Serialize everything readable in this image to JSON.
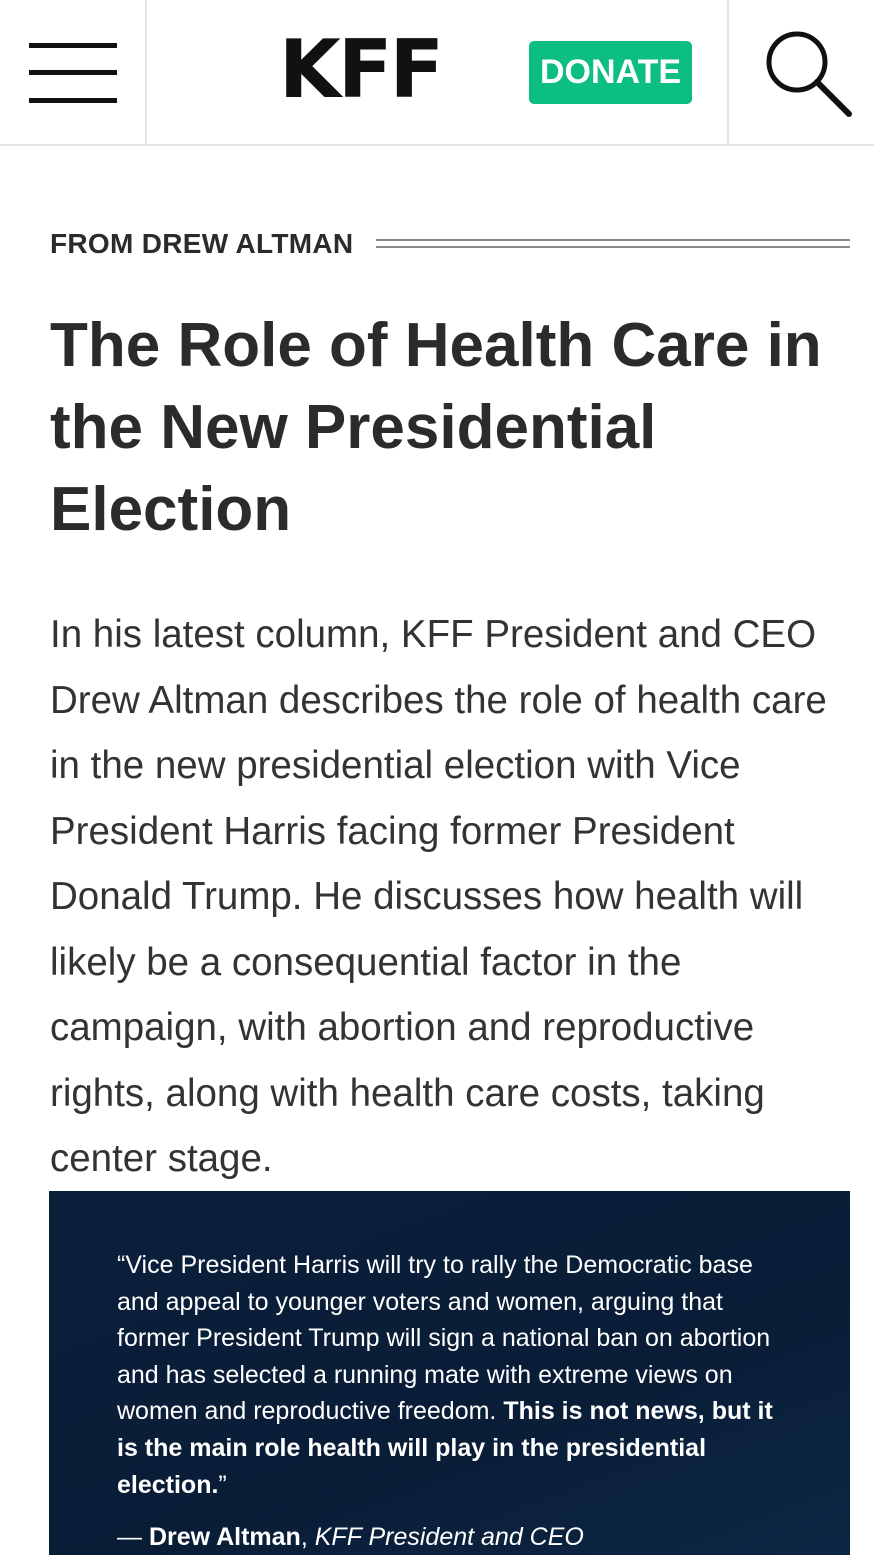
{
  "header": {
    "menu_icon": "hamburger-menu-icon",
    "logo_text": "KFF",
    "donate_label": "DONATE",
    "search_icon": "search-icon",
    "accent_color": "#0cbd84"
  },
  "article": {
    "kicker": "FROM DREW ALTMAN",
    "title": "The Role of Health Care in the New Presidential Election",
    "lede": "In his latest column, KFF President and CEO Drew Altman describes the role of health care in the new presidential election with Vice President Harris facing former President Donald Trump. He discusses how health will likely be a consequential factor in the campaign, with abortion and reproductive rights, along with health care costs, taking center stage."
  },
  "quote": {
    "open_mark": "“",
    "text_regular": "Vice President Harris will try to rally the Democratic base and appeal to younger voters and women, arguing that former President Trump will sign a national ban on abortion and has selected a running mate with extreme views on women and reproductive freedom. ",
    "text_bold": "This is not news, but it is the main role health will play in the presidential election.",
    "close_mark": "”",
    "attribution_dash": "— ",
    "attribution_name": "Drew Altman",
    "attribution_sep": ", ",
    "attribution_role": "KFF President and CEO",
    "background_color": "#0a1f3a"
  }
}
